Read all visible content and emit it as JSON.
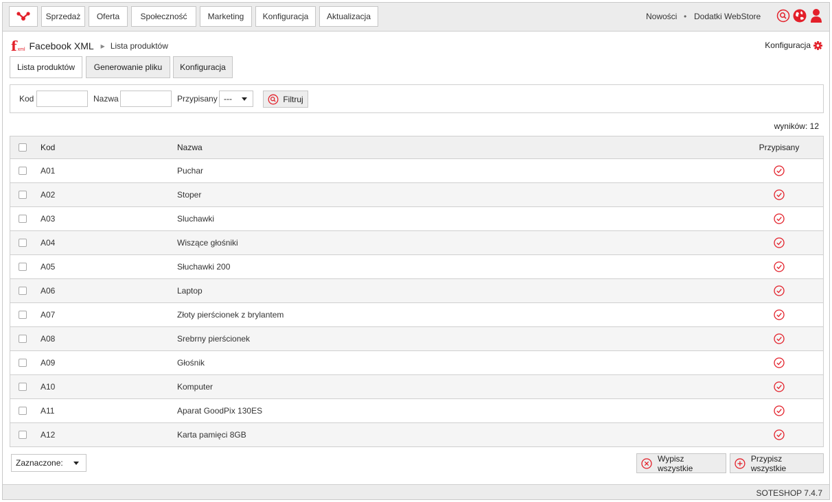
{
  "nav": {
    "items": [
      "Sprzedaż",
      "Oferta",
      "Społeczność",
      "Marketing",
      "Konfiguracja",
      "Aktualizacja"
    ],
    "right_links": {
      "news": "Nowości",
      "bullet": "•",
      "addons": "Dodatki WebStore"
    }
  },
  "breadcrumb": {
    "logo_letter": "f",
    "logo_sub": "xml",
    "module": "Facebook XML",
    "page": "Lista produktów"
  },
  "config_link": "Konfiguracja",
  "tabs": [
    "Lista produktów",
    "Generowanie pliku",
    "Konfiguracja"
  ],
  "filter": {
    "kod_label": "Kod",
    "kod_value": "",
    "nazwa_label": "Nazwa",
    "nazwa_value": "",
    "assigned_label": "Przypisany",
    "assigned_value": "---",
    "button": "Filtruj"
  },
  "results": "wyników: 12",
  "table": {
    "headers": {
      "kod": "Kod",
      "nazwa": "Nazwa",
      "przypisany": "Przypisany"
    },
    "rows": [
      {
        "kod": "A01",
        "nazwa": "Puchar"
      },
      {
        "kod": "A02",
        "nazwa": "Stoper"
      },
      {
        "kod": "A03",
        "nazwa": "Sluchawki"
      },
      {
        "kod": "A04",
        "nazwa": "Wiszące głośniki"
      },
      {
        "kod": "A05",
        "nazwa": "Słuchawki 200"
      },
      {
        "kod": "A06",
        "nazwa": "Laptop"
      },
      {
        "kod": "A07",
        "nazwa": "Złoty pierścionek z brylantem"
      },
      {
        "kod": "A08",
        "nazwa": "Srebrny pierścionek"
      },
      {
        "kod": "A09",
        "nazwa": "Głośnik"
      },
      {
        "kod": "A10",
        "nazwa": "Komputer"
      },
      {
        "kod": "A11",
        "nazwa": "Aparat GoodPix 130ES"
      },
      {
        "kod": "A12",
        "nazwa": "Karta pamięci 8GB"
      }
    ]
  },
  "bottom": {
    "selected_label": "Zaznaczone:",
    "unassign_all": "Wypisz wszystkie",
    "assign_all": "Przypisz wszystkie"
  },
  "footer": "SOTESHOP 7.4.7",
  "colors": {
    "accent": "#e3202a",
    "topbar": "#ececec",
    "border": "#c6c6c6"
  }
}
